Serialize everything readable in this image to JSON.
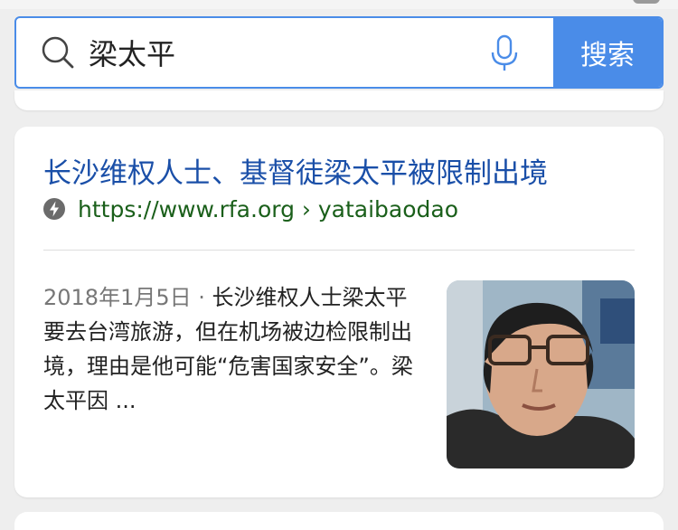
{
  "search": {
    "query": "梁太平",
    "button_label": "搜索"
  },
  "result": {
    "title": "长沙维权人士、基督徒梁太平被限制出境",
    "url": "https://www.rfa.org › yataibaodao",
    "date": "2018年1月5日",
    "separator": " · ",
    "snippet": "长沙维权人士梁太平要去台湾旅游，但在机场被边检限制出境，理由是他可能“危害国家安全”。梁太平因 ..."
  },
  "colors": {
    "accent": "#4a8ce8",
    "title_link": "#1a4fa8",
    "url_green": "#1a5f1a",
    "date_gray": "#777777"
  }
}
